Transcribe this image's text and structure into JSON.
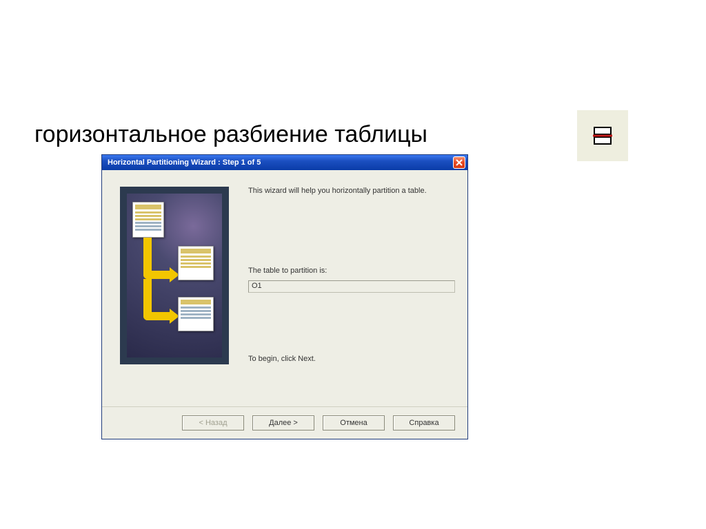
{
  "heading": "горизонтальное разбиение таблицы",
  "toolbar": {
    "icon_name": "horizontal-partition-icon"
  },
  "wizard": {
    "title": "Horizontal Partitioning Wizard : Step 1 of 5",
    "intro": "This wizard will help you horizontally partition a table.",
    "table_label": "The table to partition is:",
    "table_value": "O1",
    "begin_hint": "To begin, click Next.",
    "buttons": {
      "back": "< Назад",
      "next": "Далее >",
      "cancel": "Отмена",
      "help": "Справка"
    }
  }
}
